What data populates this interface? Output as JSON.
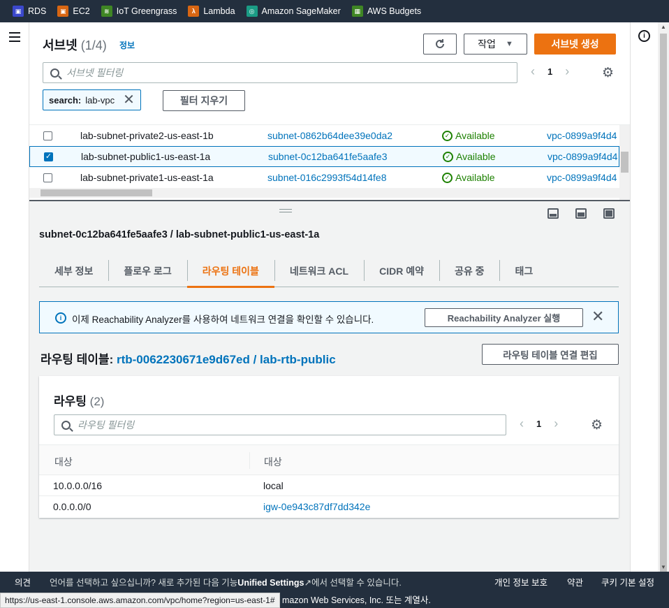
{
  "favorites": [
    {
      "label": "RDS",
      "icon": "rds-icon",
      "color": "#3b48cc"
    },
    {
      "label": "EC2",
      "icon": "ec2-icon",
      "color": "#d86613"
    },
    {
      "label": "IoT Greengrass",
      "icon": "greengrass-icon",
      "color": "#3f8624"
    },
    {
      "label": "Lambda",
      "icon": "lambda-icon",
      "color": "#d86613"
    },
    {
      "label": "Amazon SageMaker",
      "icon": "sagemaker-icon",
      "color": "#1a9c85"
    },
    {
      "label": "AWS Budgets",
      "icon": "budgets-icon",
      "color": "#3f8624"
    }
  ],
  "subnets": {
    "title": "서브넷",
    "count": "(1/4)",
    "info": "정보",
    "refresh_icon": "refresh-icon",
    "actions_label": "작업",
    "create_label": "서브넷 생성",
    "filter_placeholder": "서브넷 필터링",
    "page": "1",
    "token_key": "search:",
    "token_value": "lab-vpc",
    "clear_filter": "필터 지우기",
    "rows": [
      {
        "name": "lab-subnet-private2-us-east-1b",
        "id": "subnet-0862b64dee39e0da2",
        "status": "Available",
        "vpc": "vpc-0899a9f4d4",
        "checked": false
      },
      {
        "name": "lab-subnet-public1-us-east-1a",
        "id": "subnet-0c12ba641fe5aafe3",
        "status": "Available",
        "vpc": "vpc-0899a9f4d4",
        "checked": true
      },
      {
        "name": "lab-subnet-private1-us-east-1a",
        "id": "subnet-016c2993f54d14fe8",
        "status": "Available",
        "vpc": "vpc-0899a9f4d4",
        "checked": false
      }
    ]
  },
  "detail": {
    "title": "subnet-0c12ba641fe5aafe3 / lab-subnet-public1-us-east-1a",
    "tabs": [
      "세부 정보",
      "플로우 로그",
      "라우팅 테이블",
      "네트워크 ACL",
      "CIDR 예약",
      "공유 중",
      "태그"
    ],
    "active_tab": 2,
    "alert_text": "이제 Reachability Analyzer를 사용하여 네트워크 연결을 확인할 수 있습니다.",
    "alert_button": "Reachability Analyzer 실행",
    "rt_label": "라우팅 테이블:",
    "rt_id": "rtb-0062230671e9d67ed / lab-rtb-public",
    "rt_edit": "라우팅 테이블 연결 편집",
    "routes_title": "라우팅",
    "routes_count": "(2)",
    "routes_placeholder": "라우팅 필터링",
    "routes_page": "1",
    "col_destination": "대상",
    "col_target": "대상",
    "routes": [
      {
        "destination": "10.0.0.0/16",
        "target": "local",
        "link": false
      },
      {
        "destination": "0.0.0.0/0",
        "target": "igw-0e943c87df7dd342e",
        "link": true
      }
    ]
  },
  "footer": {
    "feedback": "의견",
    "lang_prompt": "언어를 선택하고 싶으십니까? 새로 추가된 다음 기능",
    "unified_settings": "Unified Settings",
    "lang_suffix": "에서 선택할 수 있습니다.",
    "privacy": "개인 정보 보호",
    "terms": "약관",
    "cookies": "쿠키 기본 설정",
    "copyright": "mazon Web Services, Inc. 또는 계열사.",
    "status_url": "https://us-east-1.console.aws.amazon.com/vpc/home?region=us-east-1#"
  }
}
